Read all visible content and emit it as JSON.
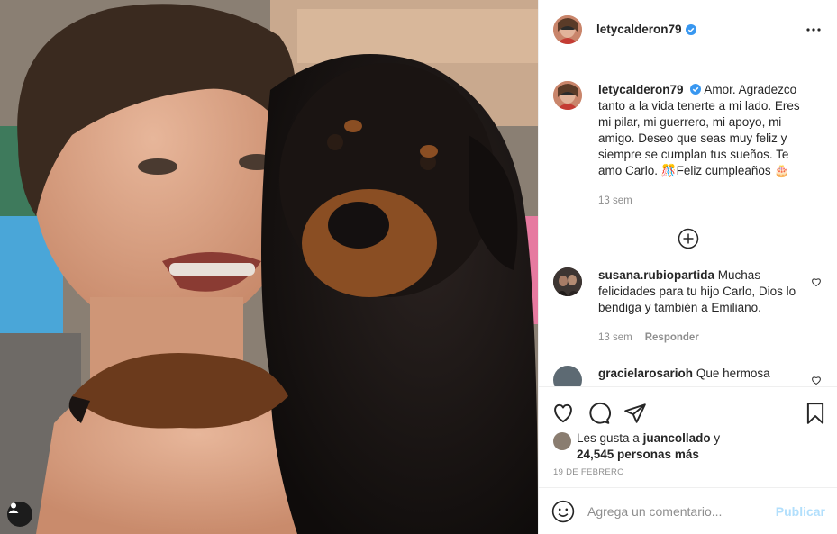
{
  "post": {
    "username": "letycalderon79",
    "caption_text": "Amor. Agradezco tanto a la vida tenerte a mi lado. Eres mi pilar, mi guerrero, mi apoyo, mi amigo. Deseo que seas muy feliz y siempre se cumplan tus sueños. Te amo Carlo. 🎊Feliz cumpleaños 🎂",
    "caption_time": "13 sem",
    "date": "19 DE FEBRERO"
  },
  "comments": [
    {
      "username": "susana.rubiopartida",
      "text": "Muchas felicidades para tu hijo Carlo, Dios lo bendiga y también a Emiliano.",
      "time": "13 sem",
      "reply_label": "Responder"
    },
    {
      "username": "gracielarosarioh",
      "text": "Que hermosa"
    }
  ],
  "likes": {
    "prefix": "Les gusta a",
    "user": "juancollado",
    "connector": "y",
    "count_text": "24,545 personas más"
  },
  "add_comment": {
    "placeholder": "Agrega un comentario...",
    "post_label": "Publicar"
  },
  "colors": {
    "verified": "#3897f0",
    "publish_disabled": "#b2dffc",
    "muted": "#8e8e8e"
  },
  "icons": [
    "more-icon",
    "verified-icon",
    "add-circle-icon",
    "heart-icon",
    "comment-icon",
    "share-icon",
    "bookmark-icon",
    "emoji-icon",
    "user-tag-icon"
  ]
}
